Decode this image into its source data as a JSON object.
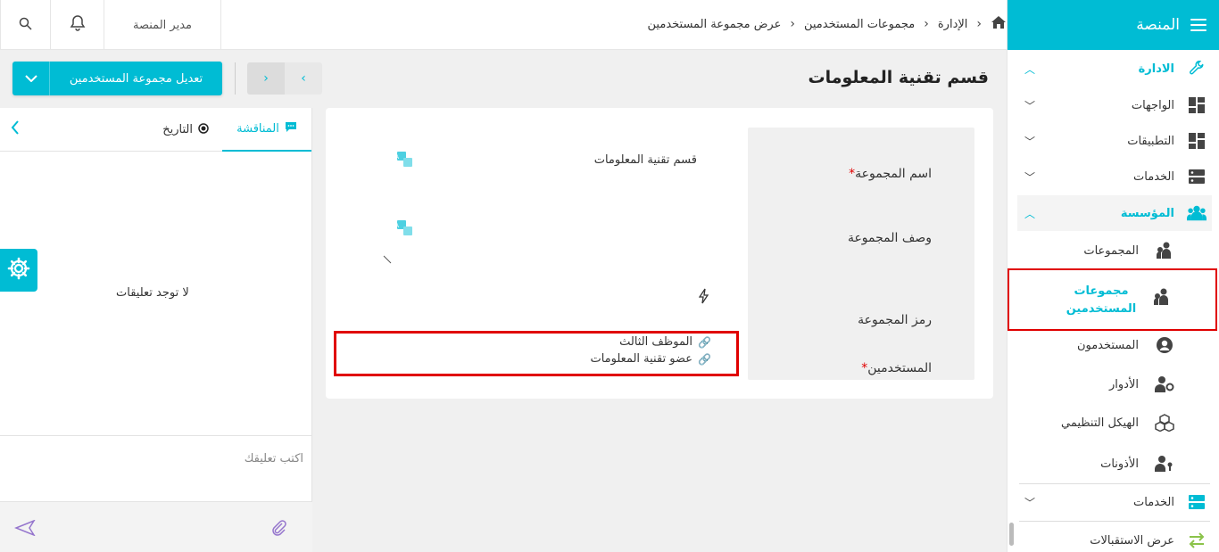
{
  "sidebar": {
    "title": "المنصة",
    "sections": [
      {
        "label": "الادارة"
      },
      {
        "label": "المؤسسة"
      }
    ],
    "items": [
      {
        "label": "الواجهات"
      },
      {
        "label": "التطبيقات"
      },
      {
        "label": "الخدمات"
      },
      {
        "label": "المجموعات"
      },
      {
        "label": "مجموعات المستخدمين"
      },
      {
        "label": "المستخدمون"
      },
      {
        "label": "الأدوار"
      },
      {
        "label": "الهيكل التنظيمي"
      },
      {
        "label": "الأذونات"
      },
      {
        "label": "الخدمات"
      },
      {
        "label": "عرض الاستقبالات"
      }
    ]
  },
  "topbar": {
    "breadcrumb": [
      "الإدارة",
      "مجموعات المستخدمين",
      "عرض مجموعة المستخدمين"
    ],
    "user_label": "مدير المنصة"
  },
  "toolbar": {
    "edit_label": "تعديل مجموعة المستخدمين"
  },
  "page": {
    "title": "قسم تقنية المعلومات"
  },
  "form": {
    "fields": [
      {
        "label": "اسم المجموعة",
        "required": true,
        "value": "قسم تقنية المعلومات"
      },
      {
        "label": "وصف المجموعة",
        "required": false,
        "value": ""
      },
      {
        "label": "رمز المجموعة",
        "required": false,
        "value": ""
      },
      {
        "label": "المستخدمين",
        "required": true
      }
    ],
    "users": [
      "الموظف الثالث",
      "عضو تقنية المعلومات"
    ]
  },
  "discussion": {
    "tab_discussion": "المناقشة",
    "tab_history": "التاريخ",
    "empty_text": "لا توجد تعليقات",
    "comment_placeholder": "اكتب تعليقك"
  },
  "colors": {
    "accent": "#00bcd4",
    "highlight": "#e00000"
  }
}
